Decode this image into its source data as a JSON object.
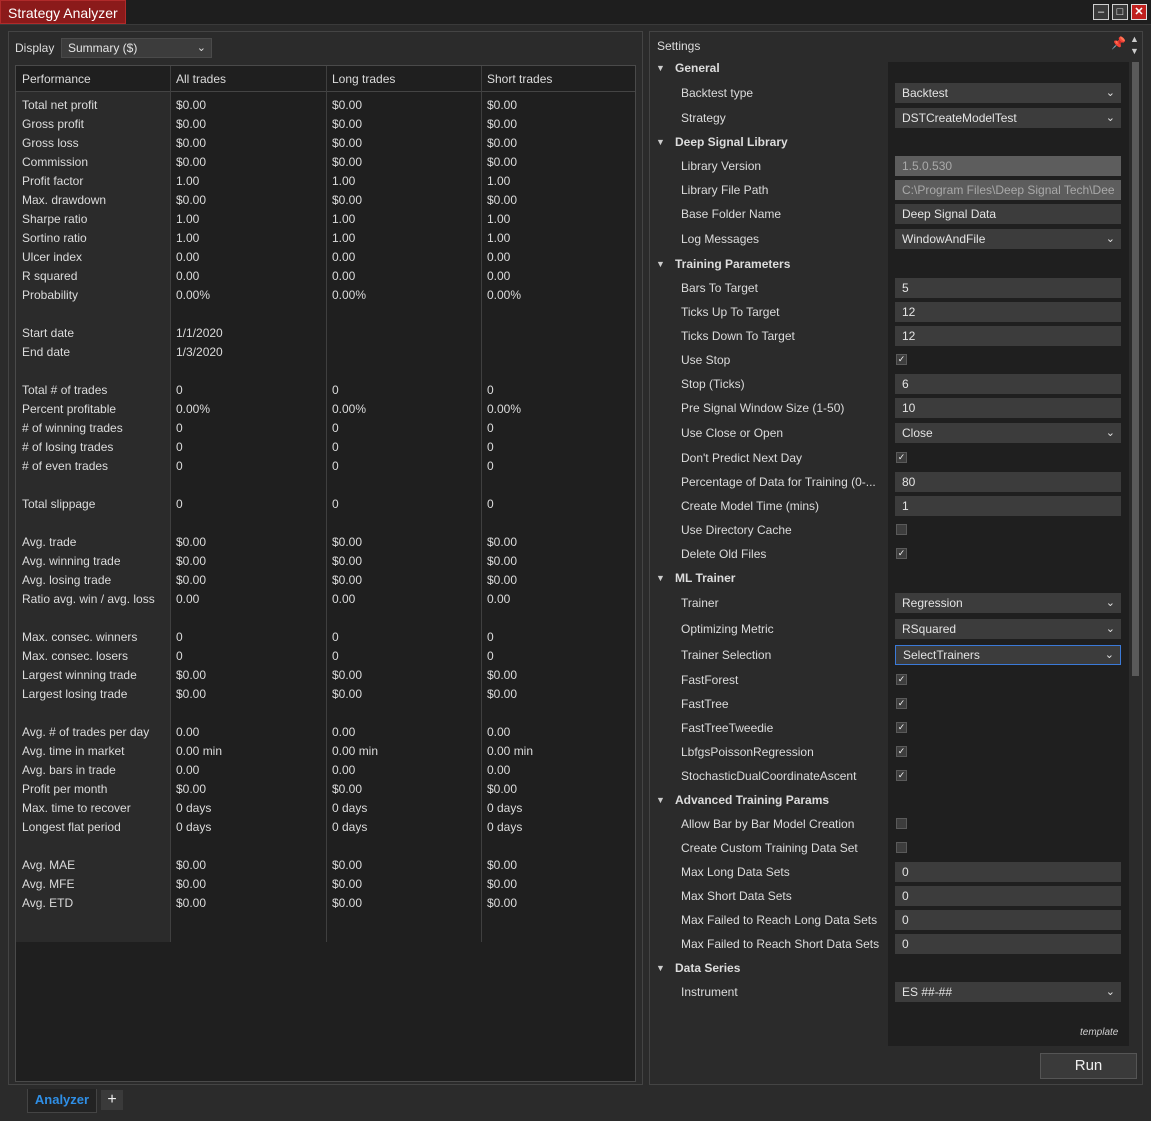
{
  "window": {
    "title": "Strategy Analyzer"
  },
  "analysis": {
    "display_label": "Display",
    "display_value": "Summary ($)",
    "headers": [
      "Performance",
      "All trades",
      "Long trades",
      "Short trades"
    ],
    "rows": [
      [
        "Total net profit",
        "$0.00",
        "$0.00",
        "$0.00"
      ],
      [
        "Gross profit",
        "$0.00",
        "$0.00",
        "$0.00"
      ],
      [
        "Gross loss",
        "$0.00",
        "$0.00",
        "$0.00"
      ],
      [
        "Commission",
        "$0.00",
        "$0.00",
        "$0.00"
      ],
      [
        "Profit factor",
        "1.00",
        "1.00",
        "1.00"
      ],
      [
        "Max. drawdown",
        "$0.00",
        "$0.00",
        "$0.00"
      ],
      [
        "Sharpe ratio",
        "1.00",
        "1.00",
        "1.00"
      ],
      [
        "Sortino ratio",
        "1.00",
        "1.00",
        "1.00"
      ],
      [
        "Ulcer index",
        "0.00",
        "0.00",
        "0.00"
      ],
      [
        "R squared",
        "0.00",
        "0.00",
        "0.00"
      ],
      [
        "Probability",
        "0.00%",
        "0.00%",
        "0.00%"
      ],
      [
        "",
        "",
        "",
        ""
      ],
      [
        "Start date",
        "1/1/2020",
        "",
        ""
      ],
      [
        "End date",
        "1/3/2020",
        "",
        ""
      ],
      [
        "",
        "",
        "",
        ""
      ],
      [
        "Total # of trades",
        "0",
        "0",
        "0"
      ],
      [
        "Percent profitable",
        "0.00%",
        "0.00%",
        "0.00%"
      ],
      [
        "# of winning trades",
        "0",
        "0",
        "0"
      ],
      [
        "# of losing trades",
        "0",
        "0",
        "0"
      ],
      [
        "# of even trades",
        "0",
        "0",
        "0"
      ],
      [
        "",
        "",
        "",
        ""
      ],
      [
        "Total slippage",
        "0",
        "0",
        "0"
      ],
      [
        "",
        "",
        "",
        ""
      ],
      [
        "Avg. trade",
        "$0.00",
        "$0.00",
        "$0.00"
      ],
      [
        "Avg. winning trade",
        "$0.00",
        "$0.00",
        "$0.00"
      ],
      [
        "Avg. losing trade",
        "$0.00",
        "$0.00",
        "$0.00"
      ],
      [
        "Ratio avg. win / avg. loss",
        "0.00",
        "0.00",
        "0.00"
      ],
      [
        "",
        "",
        "",
        ""
      ],
      [
        "Max. consec. winners",
        "0",
        "0",
        "0"
      ],
      [
        "Max. consec. losers",
        "0",
        "0",
        "0"
      ],
      [
        "Largest winning trade",
        "$0.00",
        "$0.00",
        "$0.00"
      ],
      [
        "Largest losing trade",
        "$0.00",
        "$0.00",
        "$0.00"
      ],
      [
        "",
        "",
        "",
        ""
      ],
      [
        "Avg. # of trades per day",
        "0.00",
        "0.00",
        "0.00"
      ],
      [
        "Avg. time in market",
        "0.00 min",
        "0.00 min",
        "0.00 min"
      ],
      [
        "Avg. bars in trade",
        "0.00",
        "0.00",
        "0.00"
      ],
      [
        "Profit per month",
        "$0.00",
        "$0.00",
        "$0.00"
      ],
      [
        "Max. time to recover",
        "0 days",
        "0 days",
        "0 days"
      ],
      [
        "Longest flat period",
        "0 days",
        "0 days",
        "0 days"
      ],
      [
        "",
        "",
        "",
        ""
      ],
      [
        "Avg. MAE",
        "$0.00",
        "$0.00",
        "$0.00"
      ],
      [
        "Avg. MFE",
        "$0.00",
        "$0.00",
        "$0.00"
      ],
      [
        "Avg. ETD",
        "$0.00",
        "$0.00",
        "$0.00"
      ]
    ]
  },
  "settings": {
    "title": "Settings",
    "template_label": "template",
    "run_label": "Run",
    "items": [
      {
        "kind": "category",
        "label": "General"
      },
      {
        "kind": "select",
        "label": "Backtest type",
        "value": "Backtest"
      },
      {
        "kind": "select",
        "label": "Strategy",
        "value": "DSTCreateModelTest"
      },
      {
        "kind": "category",
        "label": "Deep Signal Library"
      },
      {
        "kind": "disabled",
        "label": "Library Version",
        "value": "1.5.0.530"
      },
      {
        "kind": "disabled",
        "label": "Library File Path",
        "value": "C:\\Program Files\\Deep Signal Tech\\Dee"
      },
      {
        "kind": "text",
        "label": "Base Folder Name",
        "value": "Deep Signal Data"
      },
      {
        "kind": "select",
        "label": "Log Messages",
        "value": "WindowAndFile"
      },
      {
        "kind": "category",
        "label": "Training Parameters"
      },
      {
        "kind": "text",
        "label": "Bars To Target",
        "value": "5"
      },
      {
        "kind": "text",
        "label": "Ticks Up To Target",
        "value": "12"
      },
      {
        "kind": "text",
        "label": "Ticks Down To Target",
        "value": "12"
      },
      {
        "kind": "check",
        "label": "Use Stop",
        "checked": true
      },
      {
        "kind": "text",
        "label": "Stop (Ticks)",
        "value": "6"
      },
      {
        "kind": "text",
        "label": "Pre Signal Window Size (1-50)",
        "value": "10"
      },
      {
        "kind": "select",
        "label": "Use Close or Open",
        "value": "Close"
      },
      {
        "kind": "check",
        "label": "Don't Predict Next Day",
        "checked": true
      },
      {
        "kind": "text",
        "label": "Percentage of Data for Training (0-...",
        "value": "80"
      },
      {
        "kind": "text",
        "label": "Create Model Time (mins)",
        "value": "1"
      },
      {
        "kind": "check",
        "label": "Use Directory Cache",
        "checked": false
      },
      {
        "kind": "check",
        "label": "Delete Old Files",
        "checked": true
      },
      {
        "kind": "category",
        "label": "ML Trainer"
      },
      {
        "kind": "select",
        "label": "Trainer",
        "value": "Regression"
      },
      {
        "kind": "select",
        "label": "Optimizing Metric",
        "value": "RSquared"
      },
      {
        "kind": "select-focused",
        "label": "Trainer Selection",
        "value": "SelectTrainers"
      },
      {
        "kind": "check",
        "label": "FastForest",
        "checked": true
      },
      {
        "kind": "check",
        "label": "FastTree",
        "checked": true
      },
      {
        "kind": "check",
        "label": "FastTreeTweedie",
        "checked": true
      },
      {
        "kind": "check",
        "label": "LbfgsPoissonRegression",
        "checked": true
      },
      {
        "kind": "check",
        "label": "StochasticDualCoordinateAscent",
        "checked": true
      },
      {
        "kind": "category",
        "label": "Advanced Training Params"
      },
      {
        "kind": "check",
        "label": "Allow Bar by Bar Model Creation",
        "checked": false
      },
      {
        "kind": "check",
        "label": "Create Custom Training Data Set",
        "checked": false
      },
      {
        "kind": "text",
        "label": "Max Long Data Sets",
        "value": "0"
      },
      {
        "kind": "text",
        "label": "Max Short Data Sets",
        "value": "0"
      },
      {
        "kind": "text",
        "label": "Max Failed to Reach Long Data Sets",
        "value": "0"
      },
      {
        "kind": "text",
        "label": "Max Failed to Reach Short Data Sets",
        "value": "0"
      },
      {
        "kind": "category",
        "label": "Data Series"
      },
      {
        "kind": "select",
        "label": "Instrument",
        "value": "ES ##-##"
      }
    ]
  },
  "tabs": {
    "active_label": "Analyzer",
    "add_label": "+"
  },
  "colors": {
    "title_accent": "#8b1a1a",
    "tab_accent": "#2f8fe6",
    "focus_border": "#3b7ad8"
  }
}
